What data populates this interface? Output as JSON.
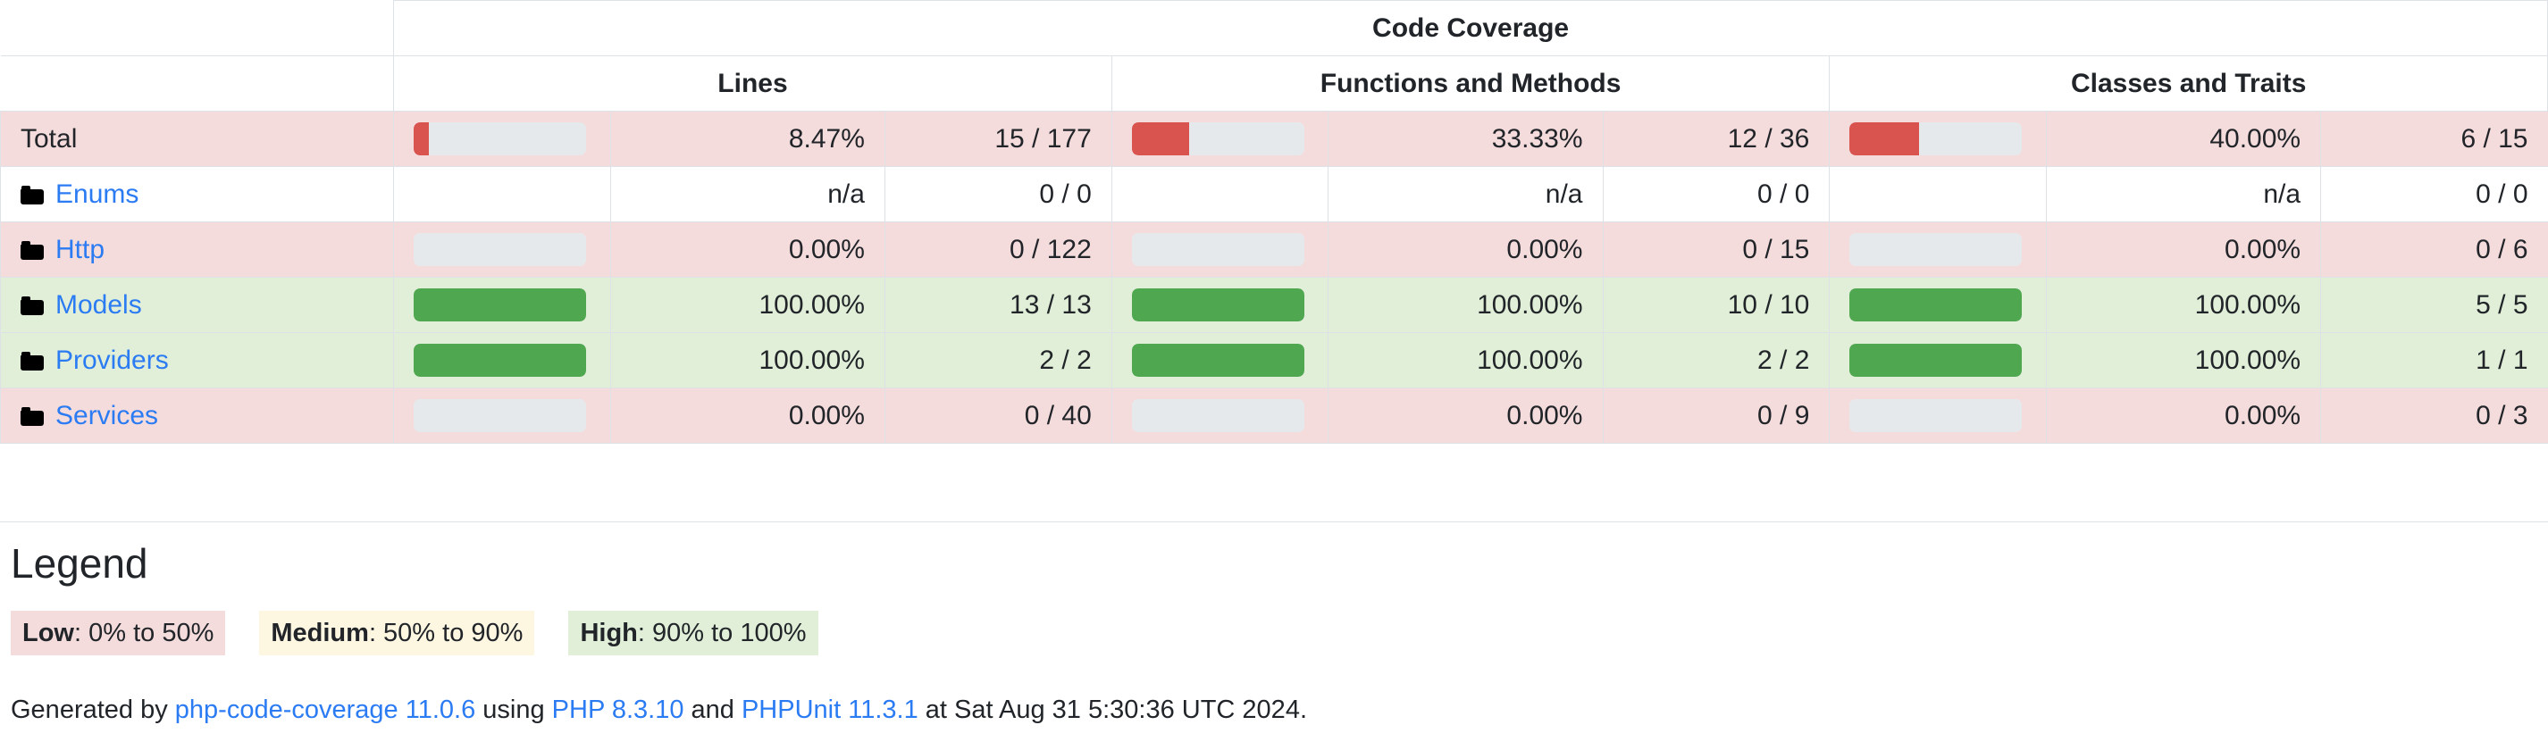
{
  "table": {
    "top_header": {
      "blank": "",
      "code_coverage": "Code Coverage"
    },
    "group_headers": {
      "blank": "",
      "lines": "Lines",
      "functions": "Functions and Methods",
      "classes": "Classes and Traits"
    },
    "rows": [
      {
        "name": "Total",
        "is_link": false,
        "level": "low",
        "lines": {
          "percent": "8.47%",
          "ratio": "15 / 177",
          "fill": 8.47,
          "bar": "danger"
        },
        "functions": {
          "percent": "33.33%",
          "ratio": "12 / 36",
          "fill": 33.33,
          "bar": "danger"
        },
        "classes": {
          "percent": "40.00%",
          "ratio": "6 / 15",
          "fill": 40.0,
          "bar": "danger"
        }
      },
      {
        "name": "Enums",
        "is_link": true,
        "level": "none",
        "lines": {
          "percent": "n/a",
          "ratio": "0 / 0",
          "fill": 0,
          "bar": "none"
        },
        "functions": {
          "percent": "n/a",
          "ratio": "0 / 0",
          "fill": 0,
          "bar": "none"
        },
        "classes": {
          "percent": "n/a",
          "ratio": "0 / 0",
          "fill": 0,
          "bar": "none"
        }
      },
      {
        "name": "Http",
        "is_link": true,
        "level": "low",
        "lines": {
          "percent": "0.00%",
          "ratio": "0 / 122",
          "fill": 0,
          "bar": "zero"
        },
        "functions": {
          "percent": "0.00%",
          "ratio": "0 / 15",
          "fill": 0,
          "bar": "zero"
        },
        "classes": {
          "percent": "0.00%",
          "ratio": "0 / 6",
          "fill": 0,
          "bar": "zero"
        }
      },
      {
        "name": "Models",
        "is_link": true,
        "level": "high",
        "lines": {
          "percent": "100.00%",
          "ratio": "13 / 13",
          "fill": 100,
          "bar": "success"
        },
        "functions": {
          "percent": "100.00%",
          "ratio": "10 / 10",
          "fill": 100,
          "bar": "success"
        },
        "classes": {
          "percent": "100.00%",
          "ratio": "5 / 5",
          "fill": 100,
          "bar": "success"
        }
      },
      {
        "name": "Providers",
        "is_link": true,
        "level": "high",
        "lines": {
          "percent": "100.00%",
          "ratio": "2 / 2",
          "fill": 100,
          "bar": "success"
        },
        "functions": {
          "percent": "100.00%",
          "ratio": "2 / 2",
          "fill": 100,
          "bar": "success"
        },
        "classes": {
          "percent": "100.00%",
          "ratio": "1 / 1",
          "fill": 100,
          "bar": "success"
        }
      },
      {
        "name": "Services",
        "is_link": true,
        "level": "low",
        "lines": {
          "percent": "0.00%",
          "ratio": "0 / 40",
          "fill": 0,
          "bar": "zero"
        },
        "functions": {
          "percent": "0.00%",
          "ratio": "0 / 9",
          "fill": 0,
          "bar": "zero"
        },
        "classes": {
          "percent": "0.00%",
          "ratio": "0 / 3",
          "fill": 0,
          "bar": "zero"
        }
      }
    ]
  },
  "legend": {
    "title": "Legend",
    "items": [
      {
        "label": "Low",
        "range": ": 0% to 50%",
        "class": "lg-low",
        "color": "#f5dcdc"
      },
      {
        "label": "Medium",
        "range": ": 50% to 90%",
        "class": "lg-med",
        "color": "#fdf6e0"
      },
      {
        "label": "High",
        "range": ": 90% to 100%",
        "class": "lg-high",
        "color": "#e1efd8"
      }
    ]
  },
  "footer": {
    "prefix": "Generated by ",
    "tool": "php-code-coverage 11.0.6",
    "mid1": " using ",
    "php": "PHP 8.3.10",
    "mid2": " and ",
    "phpunit": "PHPUnit 11.3.1",
    "suffix": " at Sat Aug 31 5:30:36 UTC 2024."
  },
  "colors": {
    "bar_danger": "#d9534f",
    "bar_success": "#4fa74f",
    "bar_track": "#e6e9ec",
    "row_low": "#f5dcdc",
    "row_high": "#e1efd8",
    "link": "#2b7bf3",
    "border": "#dee2e6"
  }
}
